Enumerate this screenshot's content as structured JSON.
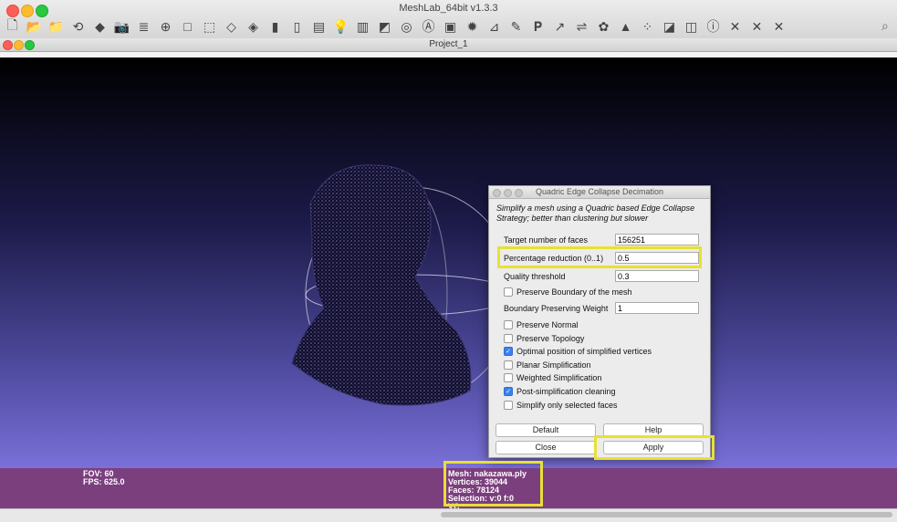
{
  "app": {
    "title": "MeshLab_64bit v1.3.3",
    "document_title": "Project_1"
  },
  "toolbar": {
    "icons": [
      "new-file-icon",
      "open-folder-icon",
      "open-project-icon",
      "reload-icon",
      "import-mesh-icon",
      "snapshot-icon",
      "layers-icon",
      "align-icon",
      "box-view-icon",
      "points-view-icon",
      "wireframe-icon",
      "hidden-lines-icon",
      "flat-shading-icon",
      "smooth-shading-icon",
      "texture-icon",
      "lighting-icon",
      "double-side-light-icon",
      "backface-icon",
      "trackball-icon",
      "annotation-a-icon",
      "meshlab-logo-icon",
      "color-filter-icon",
      "measure-icon",
      "paint-icon",
      "brush-icon",
      "pickpoint-icon",
      "align-points-icon",
      "z-painting-icon",
      "select-faces-icon",
      "select-vertices-icon",
      "select-area-icon",
      "edit-quality-icon",
      "info-icon",
      "delete-faces-icon",
      "delete-vertices-icon",
      "delete-selection-icon"
    ],
    "glyphs": [
      "🗋",
      "📂",
      "📁",
      "⟲",
      "◆",
      "📷",
      "≣",
      "⊕",
      "□",
      "⬚",
      "◇",
      "◈",
      "▮",
      "▯",
      "▤",
      "💡",
      "▥",
      "◩",
      "◎",
      "Ⓐ",
      "▣",
      "✹",
      "⊿",
      "✎",
      "𝐏",
      "↗",
      "⇌",
      "✿",
      "▲",
      "⁘",
      "◪",
      "◫",
      "ⓘ",
      "✕",
      "✕",
      "✕"
    ]
  },
  "viewport": {
    "fov_label": "FOV: 60",
    "fps_label": "FPS:  625.0",
    "mesh_lines": [
      "Mesh: nakazawa.ply",
      "Vertices: 39044",
      "Faces: 78124",
      "Selection: v:0 f:0",
      "VC"
    ]
  },
  "dialog": {
    "title": "Quadric Edge Collapse Decimation",
    "description": "Simplify a mesh using a Quadric based Edge Collapse Strategy; better than clustering but slower",
    "fields": [
      {
        "label": "Target number of faces",
        "value": "156251"
      },
      {
        "label": "Percentage reduction (0..1)",
        "value": "0.5"
      },
      {
        "label": "Quality threshold",
        "value": "0.3"
      },
      {
        "label": "Boundary Preserving Weight",
        "value": "1"
      }
    ],
    "checkbox_boundary": {
      "label": "Preserve Boundary of the mesh",
      "checked": false
    },
    "checkboxes": [
      {
        "label": "Preserve Normal",
        "checked": false
      },
      {
        "label": "Preserve Topology",
        "checked": false
      },
      {
        "label": "Optimal position of simplified vertices",
        "checked": true
      },
      {
        "label": "Planar Simplification",
        "checked": false
      },
      {
        "label": "Weighted Simplification",
        "checked": false
      },
      {
        "label": "Post-simplification cleaning",
        "checked": true
      },
      {
        "label": "Simplify only selected faces",
        "checked": false
      }
    ],
    "buttons": {
      "default": "Default",
      "help": "Help",
      "close": "Close",
      "apply": "Apply"
    }
  },
  "colors": {
    "highlight": "#e8e036",
    "infobar": "#7c3f7e",
    "checkbox_on": "#3b82f0"
  }
}
